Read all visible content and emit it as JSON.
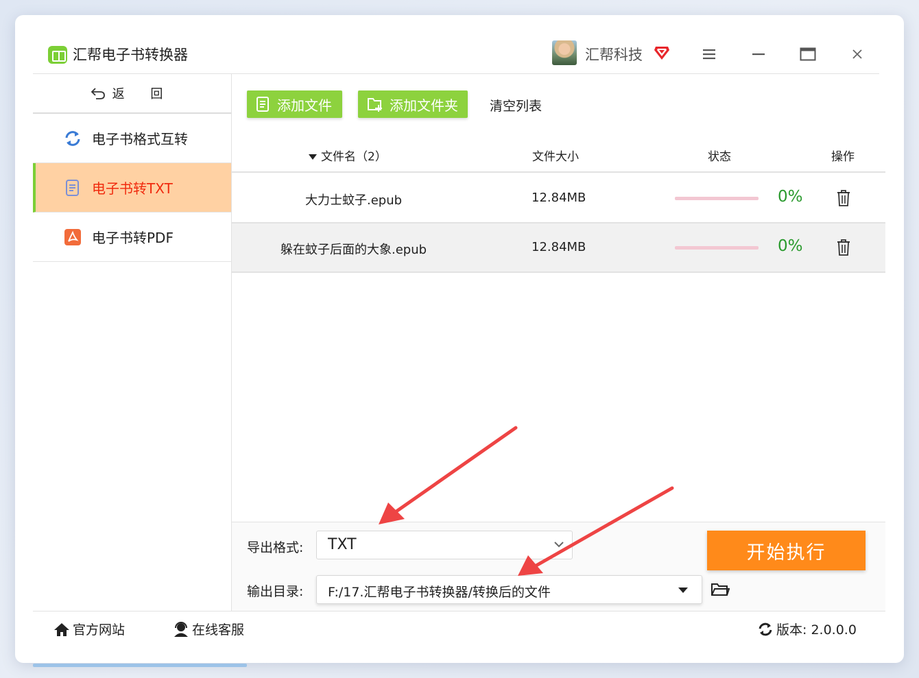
{
  "app": {
    "title": "汇帮电子书转换器",
    "user_name": "汇帮科技",
    "accent_green": "#8dd23e",
    "accent_orange": "#ff8a1a",
    "active_nav_bg": "#ffd1a3",
    "active_nav_text": "#f02a0e"
  },
  "sidebar": {
    "back_label": "返 回",
    "items": [
      {
        "label": "电子书格式互转",
        "icon": "refresh-icon",
        "active": false
      },
      {
        "label": "电子书转TXT",
        "icon": "document-icon",
        "active": true
      },
      {
        "label": "电子书转PDF",
        "icon": "pdf-icon",
        "active": false
      }
    ]
  },
  "toolbar": {
    "add_file": "添加文件",
    "add_folder": "添加文件夹",
    "clear_list": "清空列表"
  },
  "table": {
    "columns": {
      "name": "文件名（2）",
      "size": "文件大小",
      "status": "状态",
      "op": "操作"
    },
    "rows": [
      {
        "name": "大力士蚊子.epub",
        "size": "12.84MB",
        "progress": "0%"
      },
      {
        "name": "躲在蚊子后面的大象.epub",
        "size": "12.84MB",
        "progress": "0%"
      }
    ]
  },
  "output": {
    "format_label": "导出格式:",
    "format_value": "TXT",
    "dir_label": "输出目录:",
    "dir_value": "F:/17.汇帮电子书转换器/转换后的文件",
    "start_label": "开始执行"
  },
  "footer": {
    "site": "官方网站",
    "service": "在线客服",
    "version": "版本: 2.0.0.0"
  }
}
